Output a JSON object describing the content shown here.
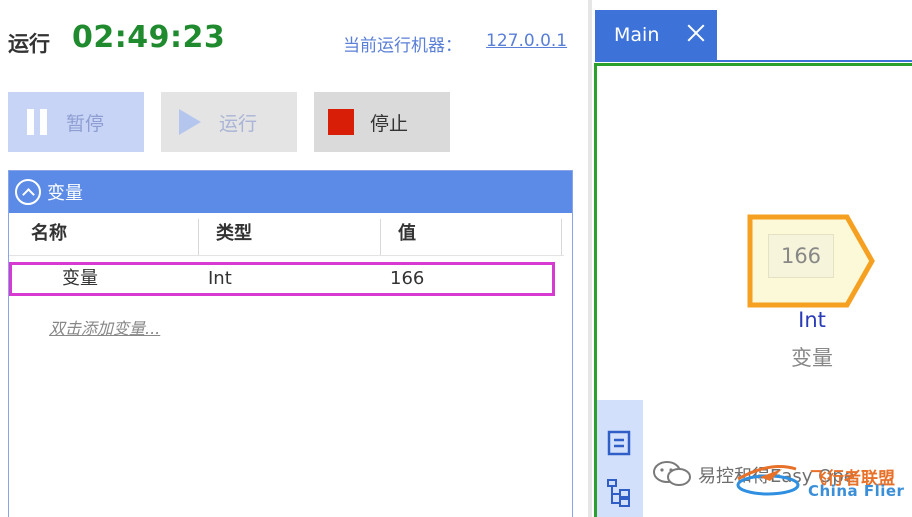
{
  "status": {
    "label": "运行",
    "timer": "02:49:23",
    "machine_label": "当前运行机器：",
    "machine_ip": "127.0.0.1",
    "timer_color": "#1f8a2e"
  },
  "toolbar": {
    "pause_label": "暂停",
    "run_label": "运行",
    "stop_label": "停止",
    "stop_color": "#d81e06"
  },
  "variables": {
    "title": "变量",
    "columns": [
      "名称",
      "类型",
      "值"
    ],
    "rows": [
      {
        "name": "变量",
        "type": "Int",
        "value": "166"
      }
    ],
    "add_hint": "双击添加变量...",
    "highlight_color": "#d63ad0"
  },
  "editor": {
    "tab_label": "Main",
    "accent_color": "#3d72d8",
    "canvas_border_color": "#2ca02c",
    "node": {
      "value": "166",
      "type": "Int",
      "name": "变量",
      "border_color": "#f5a020",
      "fill_color": "#fcf9d8"
    },
    "tools": [
      "copy-icon",
      "tree-structure-icon"
    ]
  },
  "watermark": {
    "text": "易控和得Easy Ope",
    "cn": "飞行者联盟",
    "en": "China Flier"
  }
}
